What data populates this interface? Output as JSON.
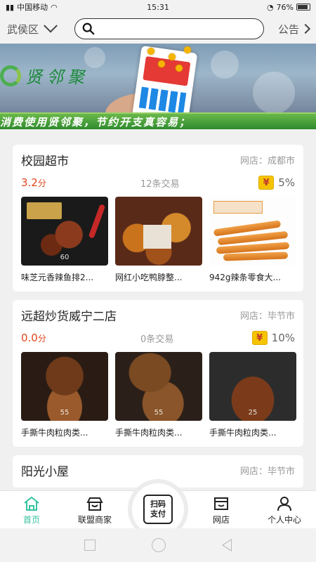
{
  "status_bar": {
    "carrier": "中国移动",
    "time": "15:31",
    "battery": "76%"
  },
  "header": {
    "district": "武侯区",
    "search_placeholder": "",
    "notice": "公告"
  },
  "banner": {
    "logo_text": "贤邻聚",
    "ticker": "消费使用贤邻聚，节约开支真容易；"
  },
  "stores": [
    {
      "name": "校园超市",
      "location": "网店：成都市",
      "score": "3.2",
      "score_unit": "分",
      "trades": "12条交易",
      "rate": "5%",
      "products": [
        {
          "name": "味芝元香辣鱼排2...",
          "image": "fish-fillet-snack",
          "tag": "60"
        },
        {
          "name": "网红小吃鸭脖整...",
          "image": "duck-neck-snacks",
          "tag": ""
        },
        {
          "name": "942g辣条零食大...",
          "image": "spicy-strip-snack",
          "tag": ""
        }
      ]
    },
    {
      "name": "远超炒货威宁二店",
      "location": "网店：毕节市",
      "score": "0.0",
      "score_unit": "分",
      "trades": "0条交易",
      "rate": "10%",
      "products": [
        {
          "name": "手撕牛肉粒肉类...",
          "image": "beef-jerky",
          "tag": "55"
        },
        {
          "name": "手撕牛肉粒肉类...",
          "image": "beef-jerky",
          "tag": "55"
        },
        {
          "name": "手撕牛肉粒肉类...",
          "image": "beef-jerky",
          "tag": "25"
        }
      ]
    },
    {
      "name": "阳光小屋",
      "location": "网店：毕节市"
    }
  ],
  "bottom_nav": {
    "home": "首页",
    "alliance": "联盟商家",
    "scan_line1": "扫码",
    "scan_line2": "支付",
    "shop": "网店",
    "profile": "个人中心"
  },
  "colors": {
    "accent": "#35c2a1",
    "score_red": "#e0471d",
    "ticker_green": "#2e8b2e"
  }
}
